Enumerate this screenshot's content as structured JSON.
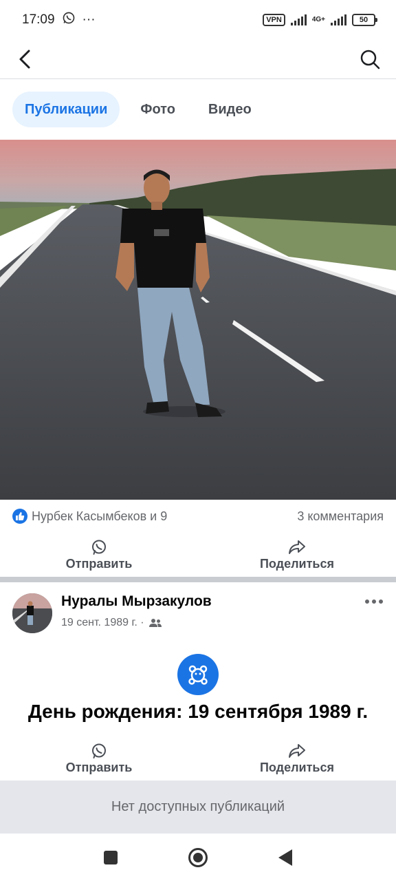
{
  "status_bar": {
    "time": "17:09",
    "more": "···",
    "vpn": "VPN",
    "network": "4G+",
    "battery": "50"
  },
  "tabs": [
    {
      "label": "Публикации",
      "active": true
    },
    {
      "label": "Фото",
      "active": false
    },
    {
      "label": "Видео",
      "active": false
    }
  ],
  "post1": {
    "likes_text": "Нурбек Касымбеков и 9",
    "comments_text": "3 комментария",
    "send_label": "Отправить",
    "share_label": "Поделиться"
  },
  "post2": {
    "author": "Нуралы Мырзакулов",
    "date": "19 сент. 1989 г. ·",
    "birthday_text": "День рождения: 19 сентября 1989 г.",
    "send_label": "Отправить",
    "share_label": "Поделиться"
  },
  "empty_state": "Нет доступных публикаций",
  "colors": {
    "accent": "#1b74e4",
    "tab_active_bg": "#e7f3ff",
    "divider": "#c9ccd1",
    "empty_bg": "#e4e6eb"
  }
}
